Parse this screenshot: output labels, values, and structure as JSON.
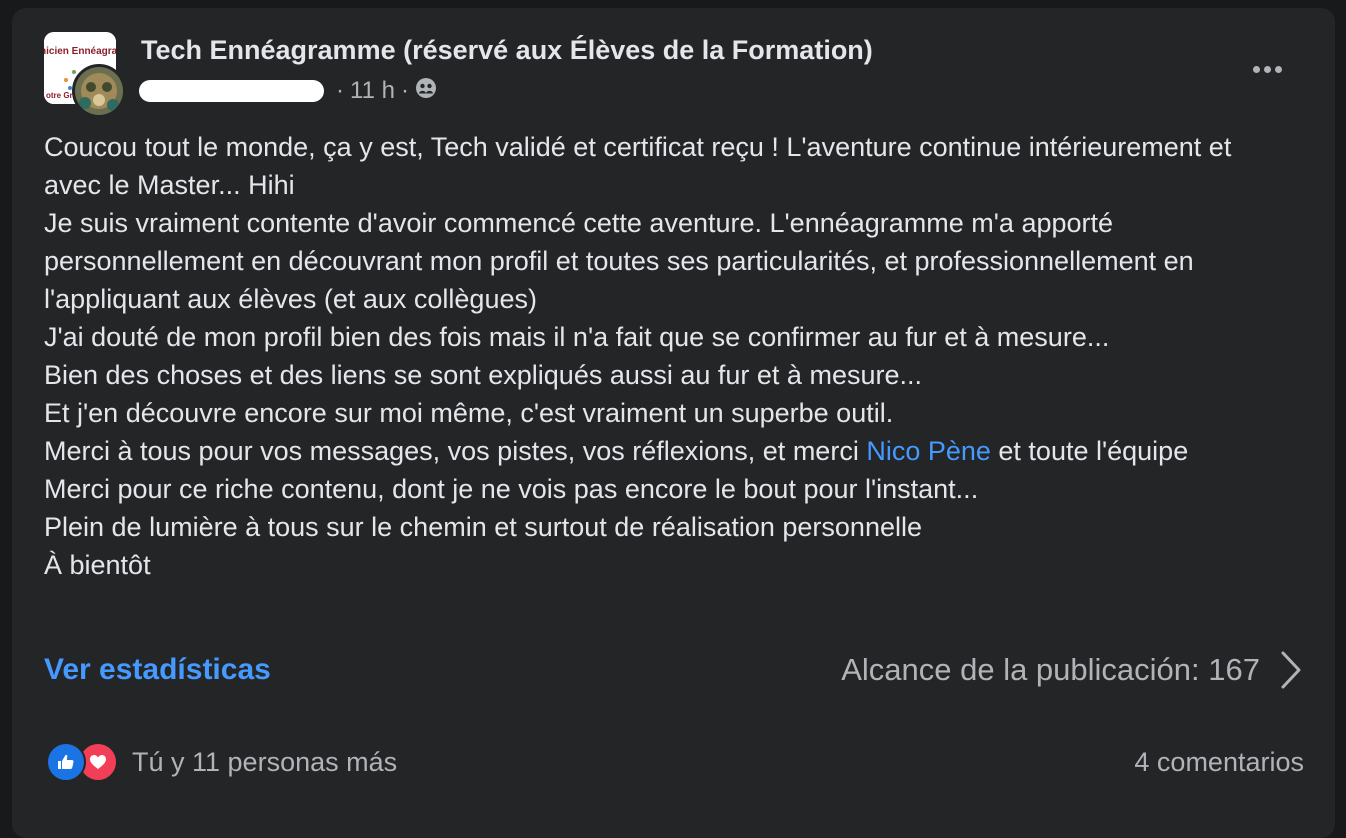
{
  "post": {
    "group_name": "Tech Ennéagramme (réservé aux Élèves de la Formation)",
    "time": "11 h",
    "separator": "·",
    "avatar_text": "nicien Ennéagram",
    "body_lines": [
      "Coucou tout le monde, ça y est, Tech validé et certificat reçu ! L'aventure continue intérieurement et avec le Master... Hihi",
      "Je suis vraiment contente d'avoir commencé cette aventure. L'ennéagramme m'a apporté personnellement en découvrant mon profil et toutes ses particularités, et professionnellement en l'appliquant aux élèves (et aux collègues)",
      "J'ai douté de mon profil bien des fois mais il n'a fait que se confirmer au fur et à mesure...",
      "Bien des choses et des liens se sont expliqués aussi au fur et à mesure...",
      "Et j'en découvre encore sur moi même, c'est vraiment un superbe outil."
    ],
    "thanks_before": "Merci à tous pour vos messages, vos pistes, vos réflexions, et merci ",
    "mention": "Nico Pène",
    "thanks_after": " et toute l'équipe",
    "body_lines_end": [
      "Merci pour ce riche contenu, dont je ne vois pas encore le bout pour l'instant...",
      "Plein de lumière à tous sur le chemin et surtout de réalisation personnelle",
      "À bientôt"
    ]
  },
  "stats": {
    "link": "Ver estadísticas",
    "reach": "Alcance de la publicación: 167"
  },
  "reactions": {
    "text": "Tú y 11 personas más",
    "comments": "4 comentarios",
    "types": [
      "like-icon",
      "love-icon"
    ]
  },
  "colors": {
    "background": "#242526",
    "text": "#e4e6eb",
    "secondary": "#b0b3b8",
    "link": "#4599ff",
    "like": "#1b74e4",
    "love": "#f33e58"
  }
}
